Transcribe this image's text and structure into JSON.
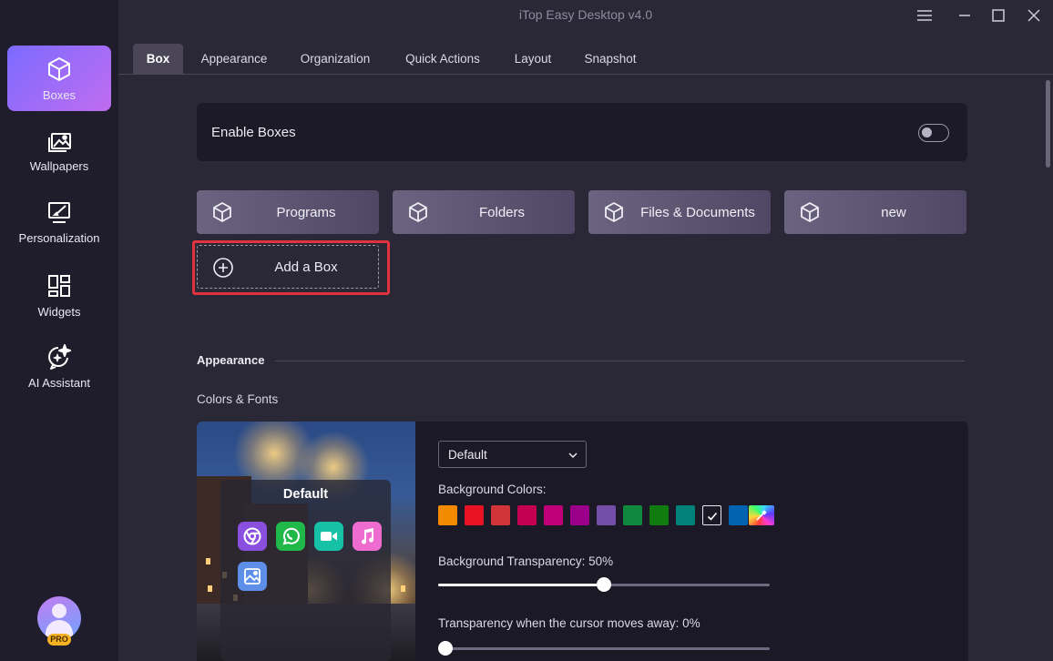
{
  "app_title": "iTop Easy Desktop v4.0",
  "sidebar": {
    "items": [
      {
        "label": "Boxes",
        "icon": "cube-icon",
        "active": true
      },
      {
        "label": "Wallpapers",
        "icon": "image-stack-icon",
        "active": false
      },
      {
        "label": "Personalization",
        "icon": "paint-monitor-icon",
        "active": false
      },
      {
        "label": "Widgets",
        "icon": "widgets-grid-icon",
        "active": false
      },
      {
        "label": "AI Assistant",
        "icon": "ai-sparkle-chat-icon",
        "active": false
      }
    ],
    "pro_badge": "PRO"
  },
  "tabs": [
    {
      "label": "Box",
      "active": true
    },
    {
      "label": "Appearance",
      "active": false
    },
    {
      "label": "Organization",
      "active": false
    },
    {
      "label": "Quick Actions",
      "active": false
    },
    {
      "label": "Layout",
      "active": false
    },
    {
      "label": "Snapshot",
      "active": false
    }
  ],
  "enable_boxes": {
    "label": "Enable Boxes",
    "enabled": false
  },
  "boxes": [
    {
      "label": "Programs"
    },
    {
      "label": "Folders"
    },
    {
      "label": "Files & Documents"
    },
    {
      "label": "new"
    }
  ],
  "add_box_label": "Add a Box",
  "appearance": {
    "section_title": "Appearance",
    "subsection_title": "Colors & Fonts",
    "preview_title": "Default",
    "preview_apps": [
      "chrome-icon",
      "whatsapp-icon",
      "facetime-icon",
      "music-icon",
      "photos-icon"
    ],
    "theme_select": "Default",
    "background_colors_label": "Background Colors:",
    "colors": [
      "#f48a00",
      "#e81224",
      "#d13438",
      "#c30052",
      "#bf0077",
      "#9a0089",
      "#744da9",
      "#10893e",
      "#107c10",
      "#00827a",
      "selected",
      "#0063b1"
    ],
    "transparency_label": "Background Transparency: 50%",
    "transparency_value": 50,
    "cursor_transparency_label": "Transparency when the cursor moves away: 0%",
    "cursor_transparency_value": 0
  }
}
